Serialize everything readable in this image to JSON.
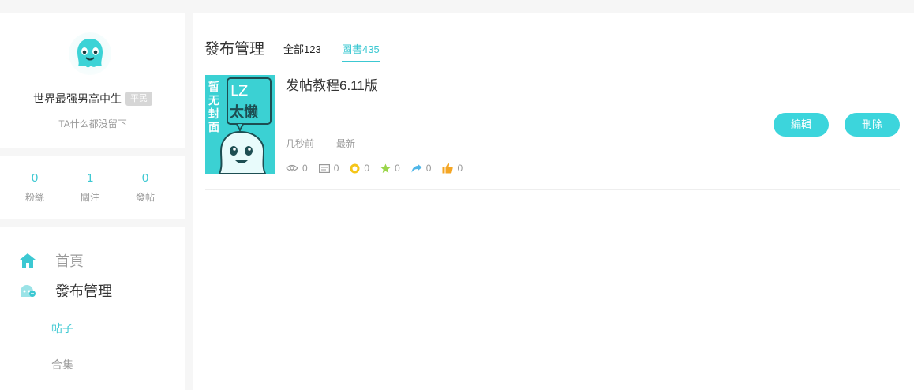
{
  "profile": {
    "username": "世界最强男高中生",
    "rank_badge": "平民",
    "bio": "TA什么都没留下"
  },
  "stats": [
    {
      "value": "0",
      "label": "粉絲"
    },
    {
      "value": "1",
      "label": "關注"
    },
    {
      "value": "0",
      "label": "發帖"
    }
  ],
  "nav": {
    "home": "首頁",
    "publish_manage": "發布管理",
    "posts": "帖子",
    "collections": "合集"
  },
  "main": {
    "title": "發布管理",
    "tabs": [
      {
        "label": "全部123",
        "active": false
      },
      {
        "label": "圖書435",
        "active": true
      }
    ]
  },
  "post": {
    "title": "发帖教程6.11版",
    "time": "几秒前",
    "tag": "最新",
    "cover_text": {
      "left": "暂无封面",
      "right_top": "LZ",
      "right_bottom": "太懒"
    },
    "stats": {
      "views": "0",
      "comments": "0",
      "coins": "0",
      "favorites": "0",
      "shares": "0",
      "likes": "0"
    },
    "edit_label": "編輯",
    "delete_label": "刪除"
  },
  "colors": {
    "accent": "#3cc8d2",
    "button": "#3cd5dc",
    "coin": "#f5c518",
    "star": "#9ad54a",
    "share": "#4fb6e8",
    "like": "#f5a623"
  }
}
